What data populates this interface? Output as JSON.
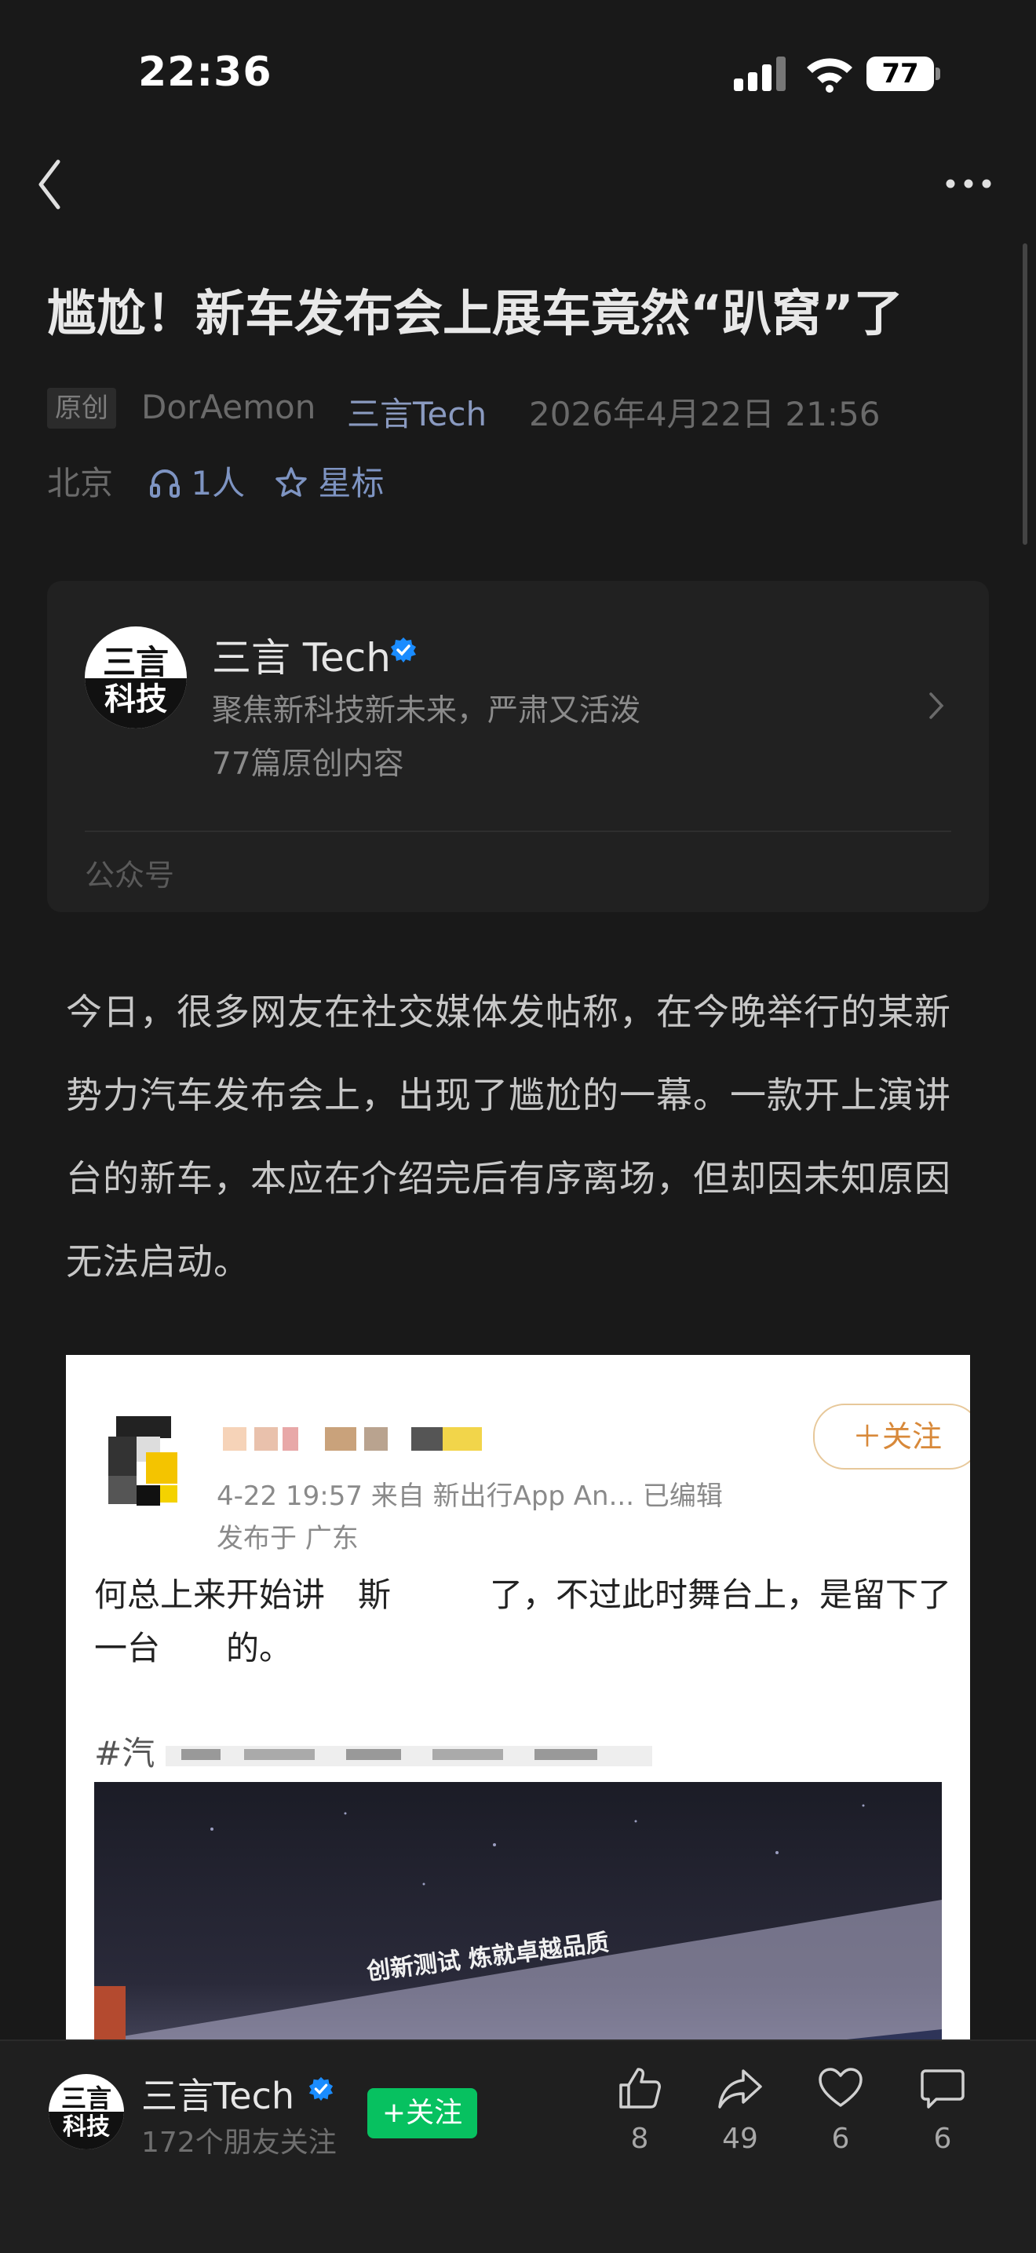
{
  "status_bar": {
    "time": "22:36",
    "battery": "77"
  },
  "article": {
    "title": "尴尬！新车发布会上展车竟然“趴窝”了",
    "original_tag": "原创",
    "author": "DorAemon",
    "account_name": "三言Tech",
    "publish_time": "2026年4月22日 21:56",
    "location": "北京",
    "listeners": "1人",
    "star_label": "星标",
    "body": "今日，很多网友在社交媒体发帖称，在今晚举行的某新势力汽车发布会上，出现了尴尬的一幕。一款开上演讲台的新车，本应在介绍完后有序离场，但却因未知原因无法启动。"
  },
  "account_card": {
    "logo_top": "三言",
    "logo_bottom": "科技",
    "name": "三言 Tech",
    "description": "聚焦新科技新未来，严肃又活泼",
    "count": "77篇原创内容",
    "type_label": "公众号"
  },
  "embedded_post": {
    "follow_label": "＋关注",
    "meta": "4-22 19:57  来自 新出行App An...  已编辑",
    "location": "发布于 广东",
    "text": "何总上来开始讲　斯　　　了，不过此时舞台上，是留下了一台　　的。",
    "hashtag": "#汽",
    "photo_caption": "创新测试 炼就卓越品质"
  },
  "bottom_bar": {
    "name": "三言Tech",
    "followers": "172个朋友关注",
    "follow_label": "+关注",
    "likes": "8",
    "shares": "49",
    "hearts": "6",
    "comments": "6"
  },
  "colors": {
    "background": "#191919",
    "accent_green": "#07c160",
    "link_blue": "#7e94c2",
    "verified_blue": "#1a8cff"
  }
}
